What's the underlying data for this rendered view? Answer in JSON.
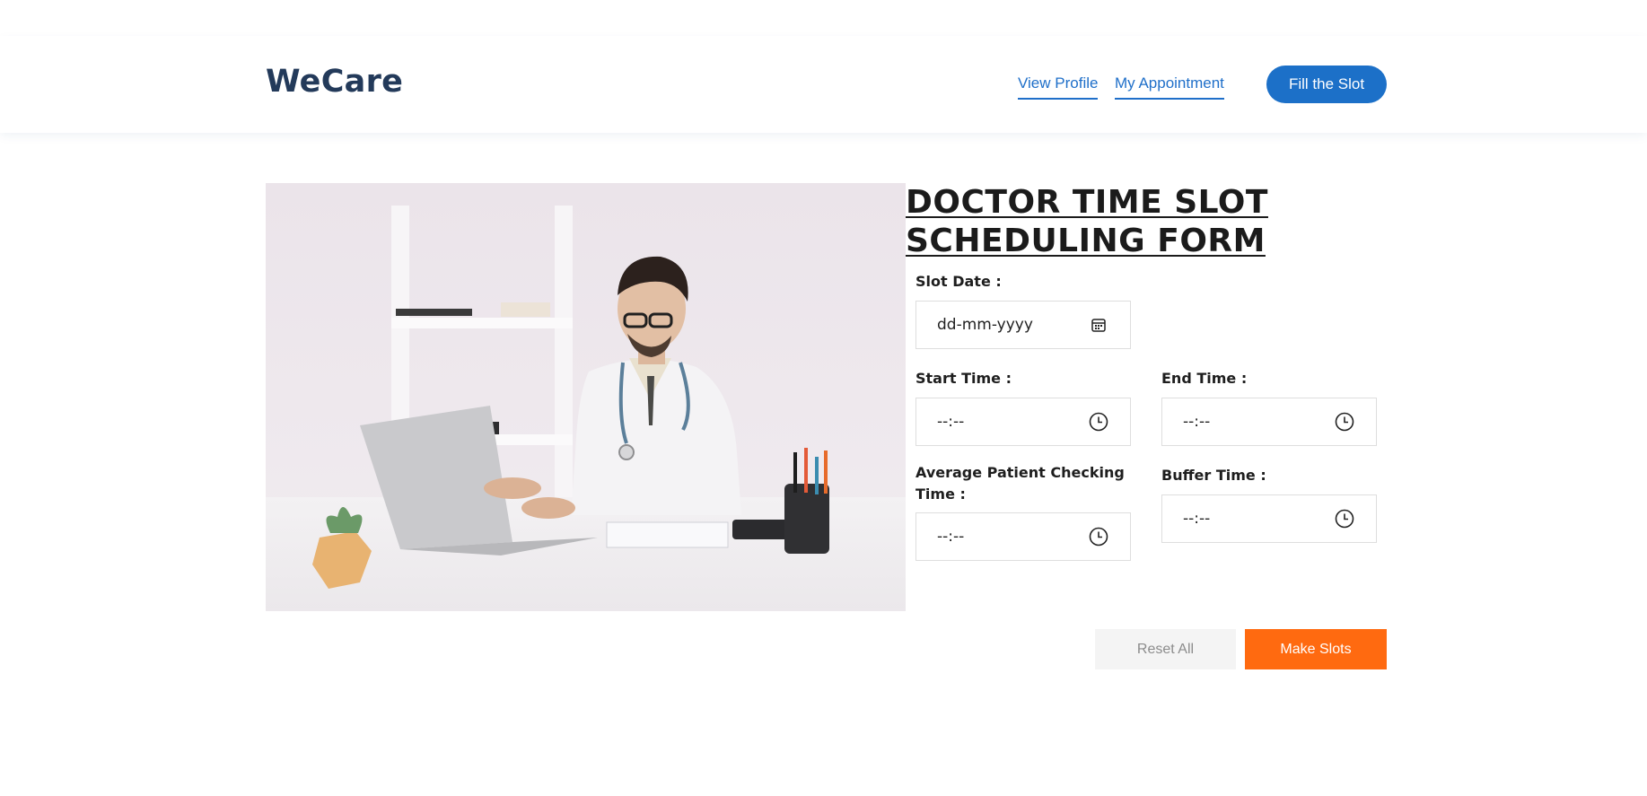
{
  "header": {
    "logo": "WeCare",
    "nav": {
      "view_profile": "View Profile",
      "my_appointment": "My Appointment"
    },
    "cta_label": "Fill the Slot"
  },
  "hero": {
    "image_icon": "doctor-at-laptop-photo"
  },
  "form": {
    "title": "DOCTOR TIME SLOT SCHEDULING FORM",
    "slot_date": {
      "label": "Slot Date :",
      "value": "dd-mm-yyyy",
      "icon": "calendar-icon"
    },
    "start_time": {
      "label": "Start Time :",
      "value": "--:--",
      "icon": "clock-icon"
    },
    "end_time": {
      "label": "End Time :",
      "value": "--:--",
      "icon": "clock-icon"
    },
    "avg_checking_time": {
      "label": "Average Patient Checking Time :",
      "value": "--:--",
      "icon": "clock-icon"
    },
    "buffer_time": {
      "label": "Buffer Time :",
      "value": "--:--",
      "icon": "clock-icon"
    }
  },
  "actions": {
    "reset_label": "Reset All",
    "submit_label": "Make Slots"
  },
  "colors": {
    "brand_dark": "#233a5a",
    "link_blue": "#1f6fc9",
    "primary_blue": "#1c70c8",
    "accent_orange": "#ff6a10"
  }
}
